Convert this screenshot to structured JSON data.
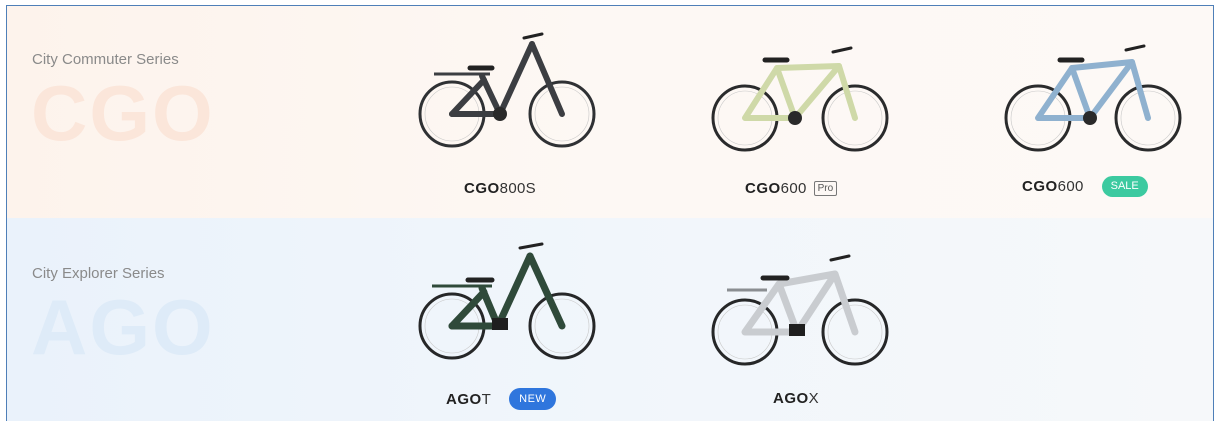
{
  "series": [
    {
      "label": "City Commuter Series",
      "watermark": "CGO",
      "products": [
        {
          "name_bold": "CGO",
          "name_rest": "800S",
          "badge": "",
          "image_alt": "bike-dark-gray-step-through"
        },
        {
          "name_bold": "CGO",
          "name_rest": "600",
          "badge": "Pro",
          "image_alt": "bike-light-green"
        },
        {
          "name_bold": "CGO",
          "name_rest": "600",
          "badge": "SALE",
          "image_alt": "bike-light-blue"
        }
      ]
    },
    {
      "label": "City Explorer Series",
      "watermark": "AGO",
      "products": [
        {
          "name_bold": "AGO",
          "name_rest": " T",
          "badge": "NEW",
          "image_alt": "bike-dark-green-step-through"
        },
        {
          "name_bold": "AGO",
          "name_rest": " X",
          "badge": "",
          "image_alt": "bike-silver"
        }
      ]
    }
  ],
  "colors": {
    "cgo_bike": "#3c3e42",
    "pro_green": "#cfd9a8",
    "sale_blue": "#8fb1cf",
    "ago_t": "#2f4a3a",
    "ago_x": "#c9ccd0",
    "sale_badge": "#3ccaa0",
    "new_badge": "#2f76dd"
  }
}
